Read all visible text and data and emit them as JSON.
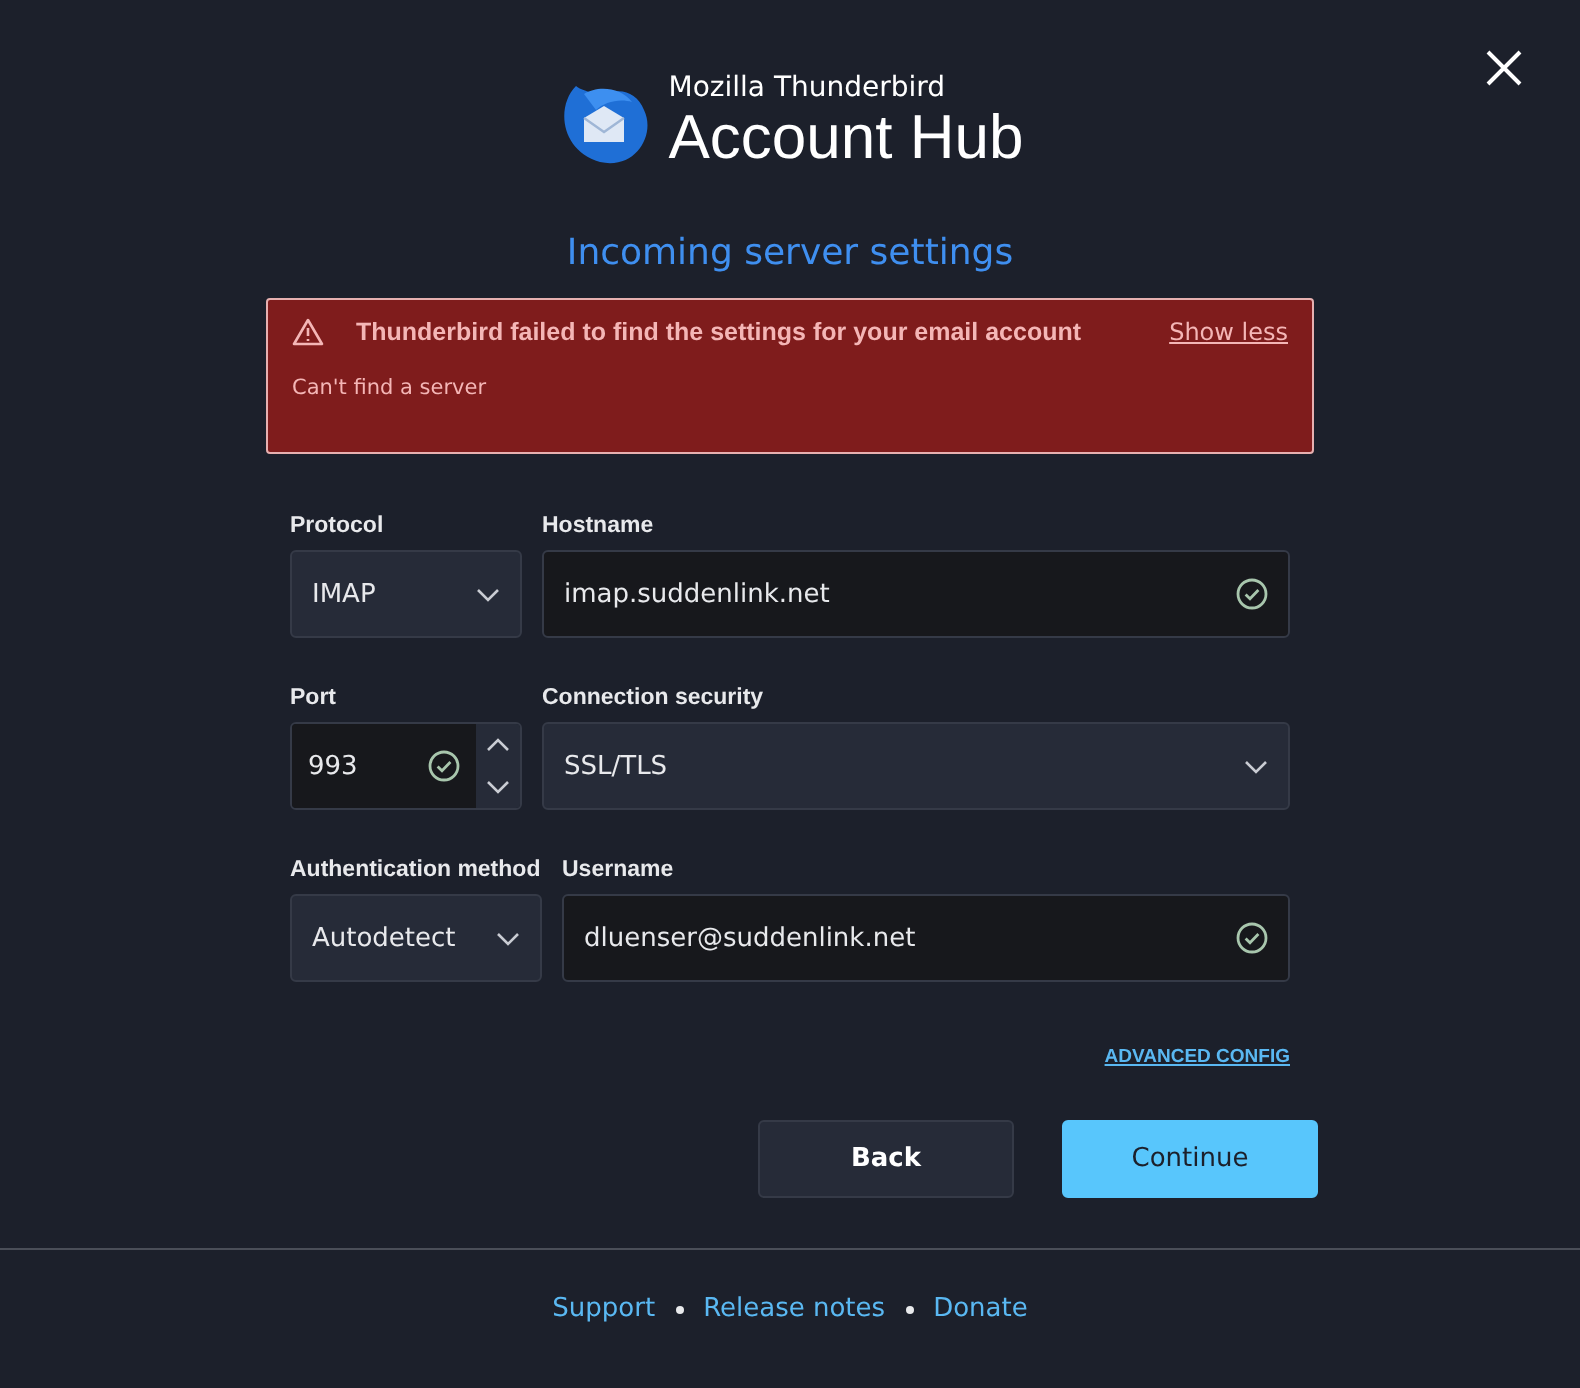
{
  "header": {
    "brand": "Mozilla Thunderbird",
    "title": "Account Hub"
  },
  "heading": "Incoming server settings",
  "alert": {
    "message": "Thunderbird failed to find the settings for your email account",
    "toggle": "Show less",
    "detail": "Can't find a server"
  },
  "rows": [
    {
      "fields": [
        {
          "kind": "select",
          "label": "Protocol",
          "value": "IMAP"
        },
        {
          "kind": "text",
          "label": "Hostname",
          "value": "imap.suddenlink.net",
          "valid": true
        }
      ]
    },
    {
      "fields": [
        {
          "kind": "number",
          "label": "Port",
          "value": "993",
          "valid": true
        },
        {
          "kind": "select",
          "label": "Connection security",
          "value": "SSL/TLS"
        }
      ]
    },
    {
      "fields": [
        {
          "kind": "select",
          "label": "Authentication method",
          "value": "Autodetect"
        },
        {
          "kind": "text",
          "label": "Username",
          "value": "dluenser@suddenlink.net",
          "valid": true
        }
      ]
    }
  ],
  "advanced_link": "ADVANCED CONFIG",
  "buttons": [
    {
      "kind": "secondary",
      "label": "Back"
    },
    {
      "kind": "primary",
      "label": "Continue"
    }
  ],
  "footer_links": [
    "Support",
    "Release notes",
    "Donate"
  ]
}
